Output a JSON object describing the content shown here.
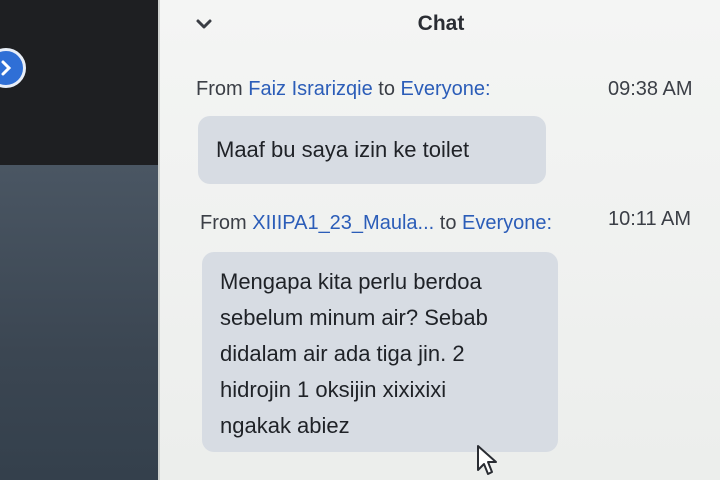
{
  "chat": {
    "title": "Chat",
    "messages": [
      {
        "from_prefix": "From",
        "sender": "Faiz Israrizqie",
        "to_word": "to",
        "recipient": "Everyone:",
        "time": "09:38 AM",
        "text": "Maaf bu saya izin ke toilet"
      },
      {
        "from_prefix": "From",
        "sender": "XIIIPA1_23_Maula...",
        "to_word": "to",
        "recipient": "Everyone:",
        "time": "10:11 AM",
        "lines": [
          "Mengapa kita perlu berdoa",
          "sebelum minum air? Sebab",
          "didalam air ada tiga jin. 2",
          "hidrojin 1 oksijin xixixixi",
          "ngakak abiez"
        ]
      }
    ]
  },
  "colors": {
    "bubble": "#d7dce3",
    "name_link": "#2b5db8",
    "panel_bg": "#f0f1f0"
  }
}
